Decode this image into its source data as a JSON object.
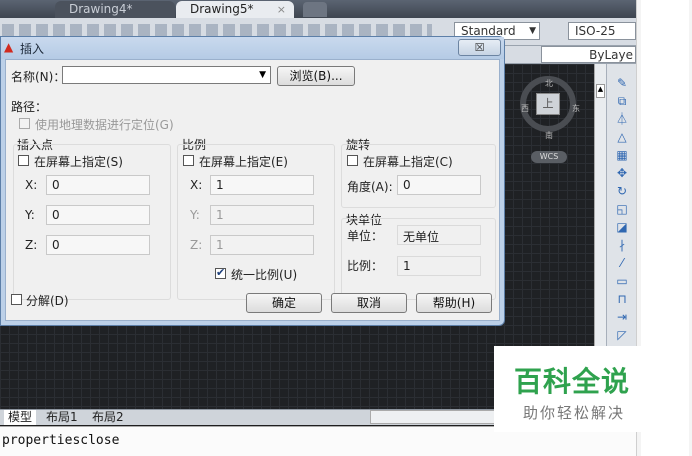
{
  "tabs": [
    {
      "label": "Drawing4*"
    },
    {
      "label": "Drawing5*",
      "close": "×"
    }
  ],
  "toolbar": {
    "style_label": "Standard",
    "dim_label": "ISO-25",
    "linetype_label": "ByLaye"
  },
  "viewcube": {
    "north": "北",
    "south": "南",
    "west": "西",
    "east": "东",
    "face": "上",
    "wcs": "WCS"
  },
  "dialog": {
    "title": "插入",
    "close_symbol": "☒",
    "name_label": "名称(N)：",
    "name_value": "",
    "browse_label": "浏览(B)...",
    "path_label": "路径：",
    "geo_label": "使用地理数据进行定位(G)",
    "insertion": {
      "title": "插入点",
      "onscreen_label": "在屏幕上指定(S)",
      "x_label": "X:",
      "x_value": "0",
      "y_label": "Y:",
      "y_value": "0",
      "z_label": "Z:",
      "z_value": "0"
    },
    "scale": {
      "title": "比例",
      "onscreen_label": "在屏幕上指定(E)",
      "x_label": "X:",
      "x_value": "1",
      "y_label": "Y:",
      "y_value": "1",
      "z_label": "Z:",
      "z_value": "1",
      "uniform_label": "统一比例(U)",
      "uniform_checked": true
    },
    "rotation": {
      "title": "旋转",
      "onscreen_label": "在屏幕上指定(C)",
      "angle_label": "角度(A):",
      "angle_value": "0"
    },
    "block_unit": {
      "title": "块单位",
      "unit_label": "单位：",
      "unit_value": "无单位",
      "factor_label": "比例：",
      "factor_value": "1"
    },
    "explode_label": "分解(D)",
    "ok_label": "确定",
    "cancel_label": "取消",
    "help_label": "帮助(H)"
  },
  "layout_tabs": [
    "模型",
    "布局1",
    "布局2"
  ],
  "command_line": "propertiesclose",
  "watermark": {
    "title": "百科全说",
    "subtitle": "助你轻松解决"
  }
}
